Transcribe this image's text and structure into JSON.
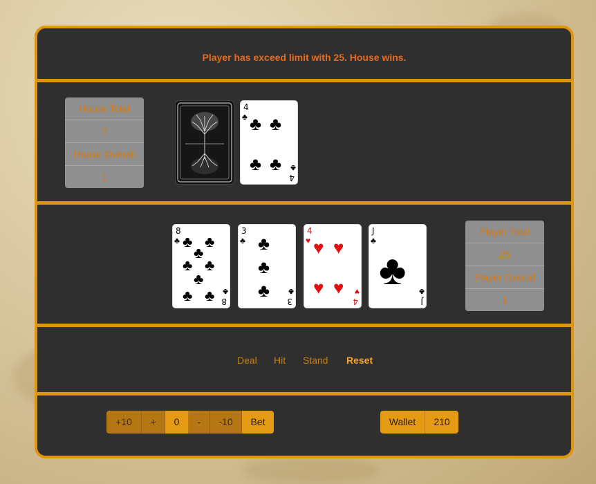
{
  "message": "Player has exceed limit with 25. House wins.",
  "house": {
    "total_label": "House Total",
    "total_value": "?",
    "overall_label": "House Overall",
    "overall_value": "1",
    "cards": [
      {
        "face_down": true
      },
      {
        "rank": "4",
        "suit": "clubs"
      }
    ]
  },
  "player": {
    "total_label": "Player Total",
    "total_value": "25",
    "overall_label": "Player Overall",
    "overall_value": "1",
    "cards": [
      {
        "rank": "8",
        "suit": "clubs"
      },
      {
        "rank": "3",
        "suit": "clubs"
      },
      {
        "rank": "4",
        "suit": "hearts"
      },
      {
        "rank": "J",
        "suit": "clubs"
      }
    ]
  },
  "controls": {
    "deal": "Deal",
    "hit": "Hit",
    "stand": "Stand",
    "reset": "Reset",
    "active": "reset"
  },
  "bet": {
    "plus10": "+10",
    "plus": "+",
    "value": "0",
    "minus": "-",
    "minus10": "-10",
    "bet": "Bet"
  },
  "wallet": {
    "label": "Wallet",
    "value": "210"
  },
  "colors": {
    "accent": "#e0950f",
    "message": "#e96a1c",
    "table": "#2f2f2f",
    "score_box": "#8f8f8f",
    "club": "#000000",
    "heart": "#e01010"
  }
}
